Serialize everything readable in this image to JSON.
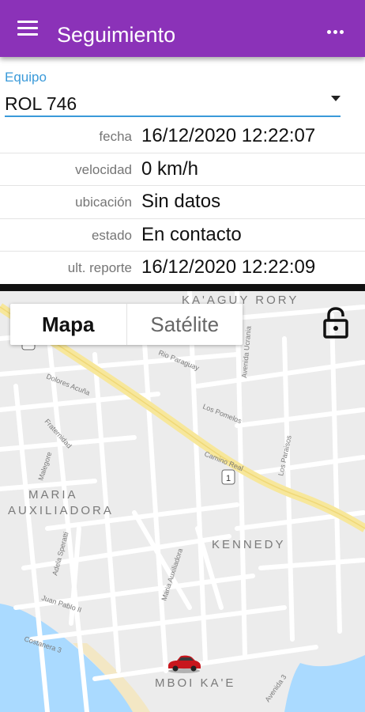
{
  "appbar": {
    "title": "Seguimiento",
    "menu_icon": "hamburger-menu-icon",
    "overflow_icon": "more-vert-icon",
    "color": "#8b32b8"
  },
  "equipo": {
    "label": "Equipo",
    "value": "ROL 746",
    "accent": "#3a9ad9"
  },
  "info_rows": [
    {
      "label": "fecha",
      "value": "16/12/2020 12:22:07"
    },
    {
      "label": "velocidad",
      "value": "0 km/h"
    },
    {
      "label": "ubicación",
      "value": "Sin datos"
    },
    {
      "label": "estado",
      "value": "En contacto"
    },
    {
      "label": "ult. reporte",
      "value": "16/12/2020 12:22:09"
    }
  ],
  "map": {
    "tabs": [
      "Mapa",
      "Satélite"
    ],
    "selected_tab": "Mapa",
    "lock_icon": "unlock-icon",
    "marker_icon": "car-icon",
    "neighborhoods": [
      "KA'AGUY RORY",
      "MARIA",
      "AUXILIADORA",
      "KENNEDY",
      "MBOI KA'E"
    ],
    "streets": [
      "Rio Paraguay",
      "Avenida Ucrania",
      "Dolores Acuña",
      "Los Pomelos",
      "Fraternidad",
      "Camino Real",
      "Los Paraisos",
      "Malegore",
      "Adela Speratti",
      "Maria Auxiliadora",
      "Juan Pablo II",
      "Costanera 3",
      "Avenida 3"
    ],
    "route_shield": "1"
  }
}
